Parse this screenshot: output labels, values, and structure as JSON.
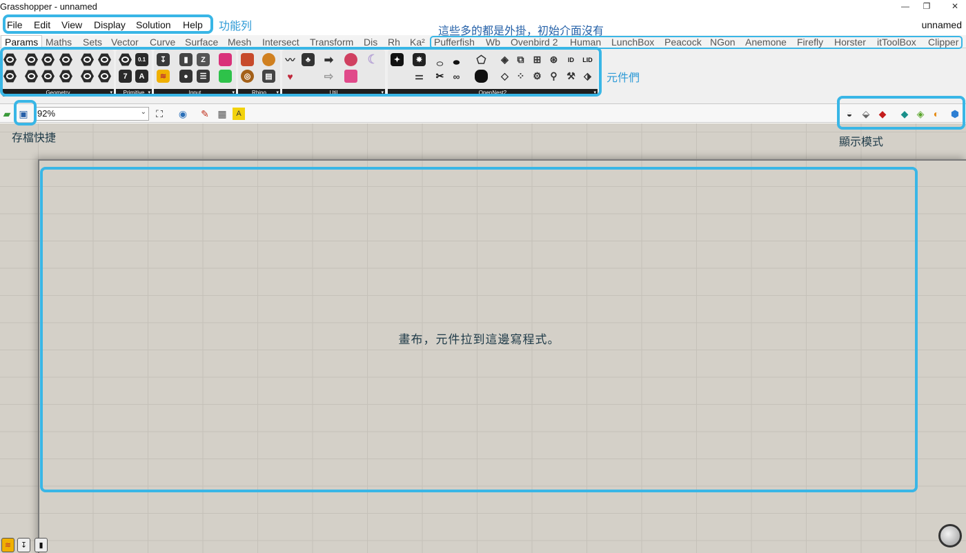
{
  "window": {
    "title": "Grasshopper - unnamed",
    "minimize_glyph": "—",
    "restore_glyph": "❐",
    "close_glyph": "✕"
  },
  "menu": {
    "items": [
      "File",
      "Edit",
      "View",
      "Display",
      "Solution",
      "Help"
    ],
    "document_name": "unnamed"
  },
  "tabs": {
    "active": "Params",
    "items": [
      "Params",
      "Maths",
      "Sets",
      "Vector",
      "Curve",
      "Surface",
      "Mesh",
      "Intersect",
      "Transform",
      "Dis",
      "Rh",
      "Ka²",
      "Pufferfish",
      "Wb",
      "Ovenbird 2",
      "Human",
      "LunchBox",
      "Peacock",
      "NGon",
      "Anemone",
      "Firefly",
      "Horster",
      "itToolBox",
      "Clipper"
    ]
  },
  "ribbon": {
    "groups": [
      "Geometry",
      "Primitive",
      "Input",
      "Rhino",
      "Util",
      "OpenNest2"
    ],
    "primitive_icons": [
      "0.1",
      "7",
      "A"
    ],
    "opennest_icons": [
      "ID",
      "LID"
    ]
  },
  "toolbar": {
    "zoom_value": "92%",
    "icons": [
      "open-file-icon",
      "save-icon",
      "zoom-extents-icon",
      "preview-eye-icon",
      "sketch-icon",
      "mesh-preview-icon",
      "label-icon"
    ],
    "display_modes": [
      "wireframe-preview-icon",
      "shaded-preview-icon",
      "selected-shaded-icon",
      "document-preview-icon",
      "custom-preview-icon",
      "color-preview-icon",
      "shape-preview-icon"
    ]
  },
  "annotations": {
    "menu_bar": "功能列",
    "plugins": "這些多的都是外掛，初始介面沒有",
    "components": "元件們",
    "save_shortcut": "存檔快捷",
    "display_mode": "顯示模式",
    "canvas": "畫布，元件拉到這邊寫程式。"
  },
  "colors": {
    "annotation_blue": "#39b6e6",
    "canvas_bg": "#d4d0c8",
    "canvas_grid": "#c5c1b9"
  }
}
